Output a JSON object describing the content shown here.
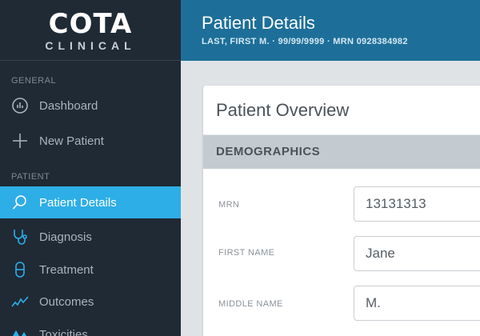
{
  "sidebar": {
    "logo": {
      "main": "COTA",
      "sub": "CLINICAL"
    },
    "sections": {
      "general": "GENERAL",
      "patient": "PATIENT"
    },
    "items": [
      {
        "label": "Dashboard",
        "icon": "dashboard-icon"
      },
      {
        "label": "New Patient",
        "icon": "plus-icon"
      },
      {
        "label": "Patient Details",
        "icon": "search-icon",
        "active": true
      },
      {
        "label": "Diagnosis",
        "icon": "stethoscope-icon"
      },
      {
        "label": "Treatment",
        "icon": "capsule-icon"
      },
      {
        "label": "Outcomes",
        "icon": "line-chart-icon"
      },
      {
        "label": "Toxicities",
        "icon": "drops-icon"
      }
    ]
  },
  "header": {
    "title": "Patient Details",
    "subtitle": "LAST, FIRST M. · 99/99/9999 · MRN 0928384982"
  },
  "card": {
    "title": "Patient Overview",
    "section": "DEMOGRAPHICS",
    "fields": [
      {
        "label": "MRN",
        "value": "13131313"
      },
      {
        "label": "FIRST NAME",
        "value": "Jane"
      },
      {
        "label": "MIDDLE NAME",
        "value": "M."
      }
    ]
  },
  "colors": {
    "sidebar_bg": "#1f2a35",
    "active_item": "#2eaee6",
    "header_bg": "#1d6f99",
    "section_bg": "#c3cbd0"
  }
}
